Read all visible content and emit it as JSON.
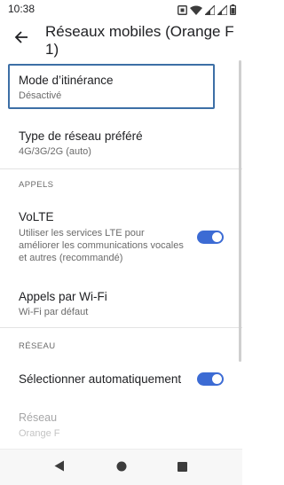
{
  "status": {
    "time": "10:38"
  },
  "app_bar": {
    "title": "Réseaux mobiles (Orange F 1)"
  },
  "settings": {
    "roaming": {
      "title": "Mode d’itinérance",
      "summary": "Désactivé"
    },
    "network_type": {
      "title": "Type de réseau préféré",
      "summary": "4G/3G/2G (auto)"
    },
    "section_calls": "APPELS",
    "volte": {
      "title": "VoLTE",
      "summary": "Utiliser les services LTE pour améliorer les communications vocales et autres (recommandé)",
      "enabled": true
    },
    "wifi_calls": {
      "title": "Appels par Wi-Fi",
      "summary": "Wi-Fi par défaut"
    },
    "section_network": "RÉSEAU",
    "auto_select": {
      "title": "Sélectionner automatiquement",
      "enabled": true
    },
    "network": {
      "title": "Réseau",
      "summary": "Orange F"
    }
  },
  "colors": {
    "accent": "#3c6bd4",
    "focus_outline": "#3d6fa6"
  },
  "icons": {
    "status": [
      "nfc-icon",
      "wifi-icon",
      "signal-icon",
      "signal-icon",
      "battery-icon"
    ],
    "nav": [
      "back-triangle-icon",
      "home-circle-icon",
      "recents-square-icon"
    ]
  }
}
